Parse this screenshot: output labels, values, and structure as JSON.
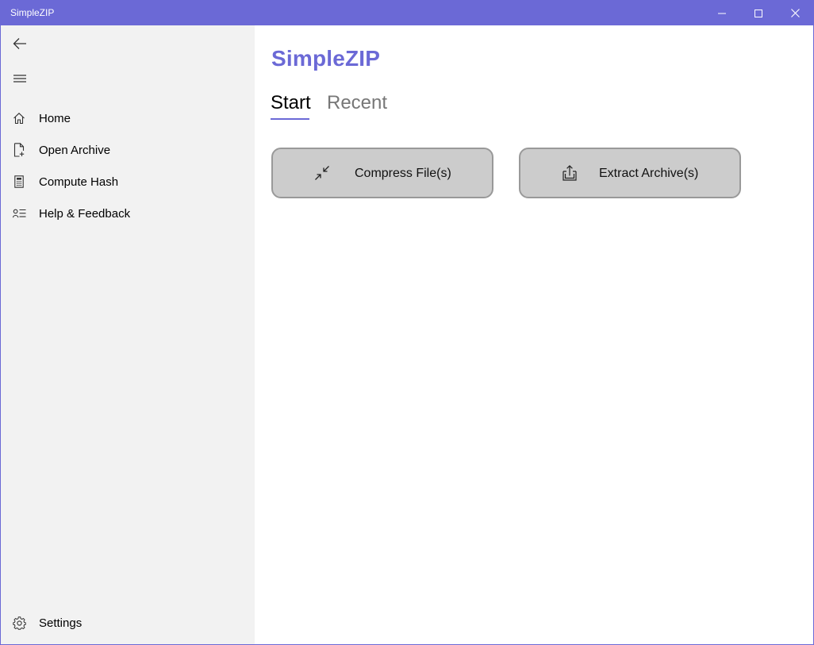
{
  "window": {
    "title": "SimpleZIP",
    "accent_color": "#6b69d6"
  },
  "titlebar": {
    "minimize_icon": "minimize-icon",
    "maximize_icon": "maximize-icon",
    "close_icon": "close-icon"
  },
  "sidebar": {
    "back_icon": "back-arrow-icon",
    "menu_icon": "hamburger-menu-icon",
    "items": [
      {
        "label": "Home",
        "icon": "home-icon"
      },
      {
        "label": "Open Archive",
        "icon": "document-add-icon"
      },
      {
        "label": "Compute Hash",
        "icon": "calculator-icon"
      },
      {
        "label": "Help & Feedback",
        "icon": "contact-list-icon"
      }
    ],
    "settings": {
      "label": "Settings",
      "icon": "gear-icon"
    }
  },
  "main": {
    "heading": "SimpleZIP",
    "tabs": [
      {
        "label": "Start",
        "selected": true
      },
      {
        "label": "Recent",
        "selected": false
      }
    ],
    "actions": [
      {
        "label": "Compress File(s)",
        "icon": "compress-arrows-icon"
      },
      {
        "label": "Extract Archive(s)",
        "icon": "extract-box-icon"
      }
    ]
  }
}
